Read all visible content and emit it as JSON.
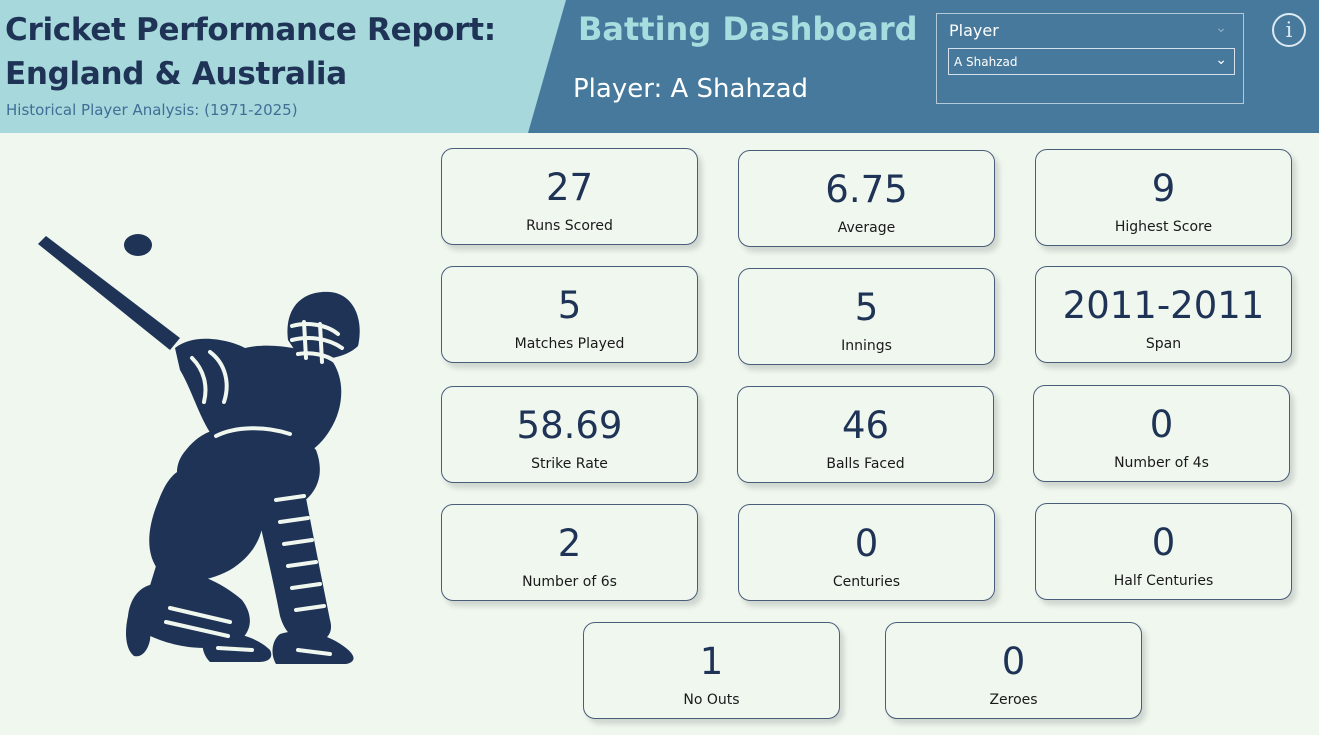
{
  "header": {
    "title_line1": "Cricket Performance Report:",
    "title_line2": "England & Australia",
    "subtitle": "Historical Player Analysis: (1971-2025)",
    "dashboard_title": "Batting Dashboard",
    "player_line": "Player: A Shahzad"
  },
  "slicer": {
    "label": "Player",
    "selected": "A Shahzad"
  },
  "info_icon": "info-icon",
  "illustration": "cricket-batsman-icon",
  "colors": {
    "navy": "#1e3355",
    "header_left": "#a6d8dc",
    "header_right": "#47799c",
    "background": "#eff7ef"
  },
  "cards": [
    {
      "value": "27",
      "label": "Runs Scored"
    },
    {
      "value": "6.75",
      "label": "Average"
    },
    {
      "value": "9",
      "label": "Highest Score"
    },
    {
      "value": "5",
      "label": "Matches Played"
    },
    {
      "value": "5",
      "label": "Innings"
    },
    {
      "value": "2011-2011",
      "label": "Span"
    },
    {
      "value": "58.69",
      "label": "Strike Rate"
    },
    {
      "value": "46",
      "label": "Balls Faced"
    },
    {
      "value": "0",
      "label": "Number of 4s"
    },
    {
      "value": "2",
      "label": "Number of 6s"
    },
    {
      "value": "0",
      "label": "Centuries"
    },
    {
      "value": "0",
      "label": "Half Centuries"
    },
    {
      "value": "1",
      "label": "No Outs"
    },
    {
      "value": "0",
      "label": "Zeroes"
    }
  ]
}
